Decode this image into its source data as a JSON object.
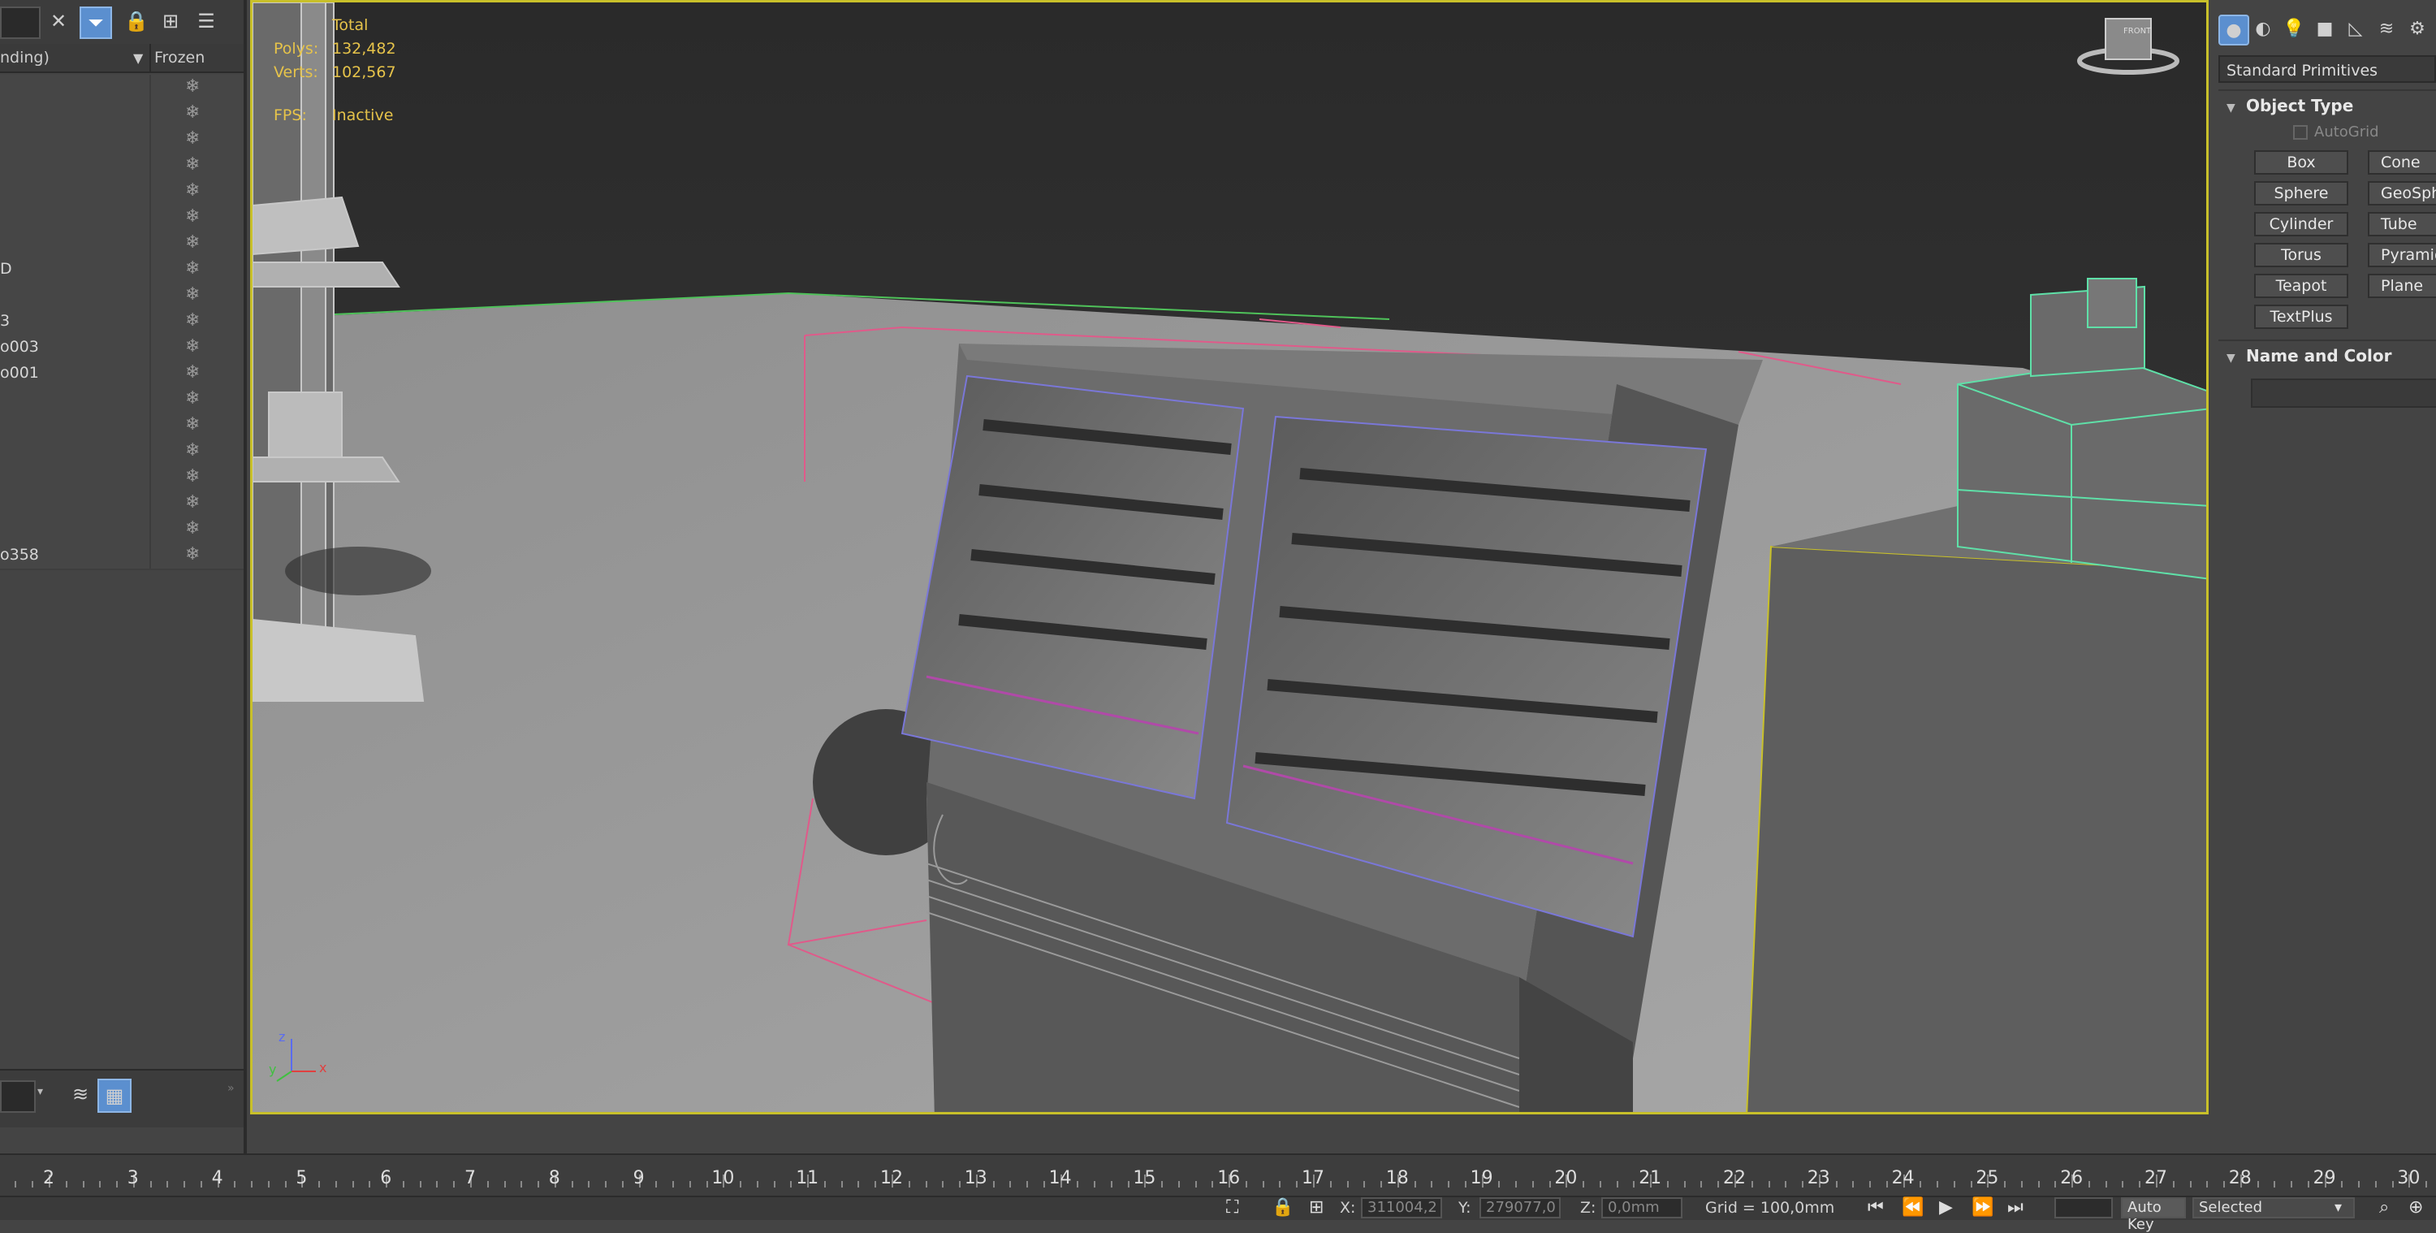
{
  "explorer": {
    "col_name": "nding)",
    "col_frozen": "Frozen",
    "rows": [
      {
        "name": ""
      },
      {
        "name": ""
      },
      {
        "name": ""
      },
      {
        "name": ""
      },
      {
        "name": ""
      },
      {
        "name": ""
      },
      {
        "name": ""
      },
      {
        "name": "D"
      },
      {
        "name": ""
      },
      {
        "name": "3"
      },
      {
        "name": "o003"
      },
      {
        "name": "o001"
      },
      {
        "name": ""
      },
      {
        "name": ""
      },
      {
        "name": ""
      },
      {
        "name": ""
      },
      {
        "name": ""
      },
      {
        "name": ""
      },
      {
        "name": "o358"
      }
    ],
    "frozen_glyph": "❄"
  },
  "viewport": {
    "stats": {
      "total_label": "Total",
      "polys_label": "Polys:",
      "polys_value": "132,482",
      "verts_label": "Verts:",
      "verts_value": "102,567",
      "fps_label": "FPS:",
      "fps_value": "Inactive"
    },
    "viewcube_label": "FRONT",
    "axis_labels": {
      "z": "z",
      "y": "y",
      "x": "x"
    },
    "colors": {
      "background": "#2e2e2e",
      "floor": "#9a9a9a",
      "selection": "#c8c02a",
      "wire": "#7a77d8",
      "bounding": "#e05a8a",
      "selected_obj": "#5fe0a8"
    }
  },
  "command_panel": {
    "category": "Standard Primitives",
    "object_type_title": "Object Type",
    "autogrid": "AutoGrid",
    "primitives": [
      "Box",
      "Cone",
      "Sphere",
      "GeoSphere",
      "Cylinder",
      "Tube",
      "Torus",
      "Pyramid",
      "Teapot",
      "Plane",
      "TextPlus"
    ],
    "name_color_title": "Name and Color"
  },
  "timeline": {
    "ticks": [
      "2",
      "3",
      "4",
      "5",
      "6",
      "7",
      "8",
      "9",
      "10",
      "11",
      "12",
      "13",
      "14",
      "15",
      "16",
      "17",
      "18",
      "19",
      "20",
      "21",
      "22",
      "23",
      "24",
      "25",
      "26",
      "27",
      "28",
      "29",
      "30"
    ]
  },
  "statusbar": {
    "x_label": "X:",
    "x_value": "311004,2",
    "y_label": "Y:",
    "y_value": "279077,0",
    "z_label": "Z:",
    "z_value": "0,0mm",
    "grid": "Grid = 100,0mm",
    "autokey": "Auto Key",
    "selected": "Selected"
  }
}
